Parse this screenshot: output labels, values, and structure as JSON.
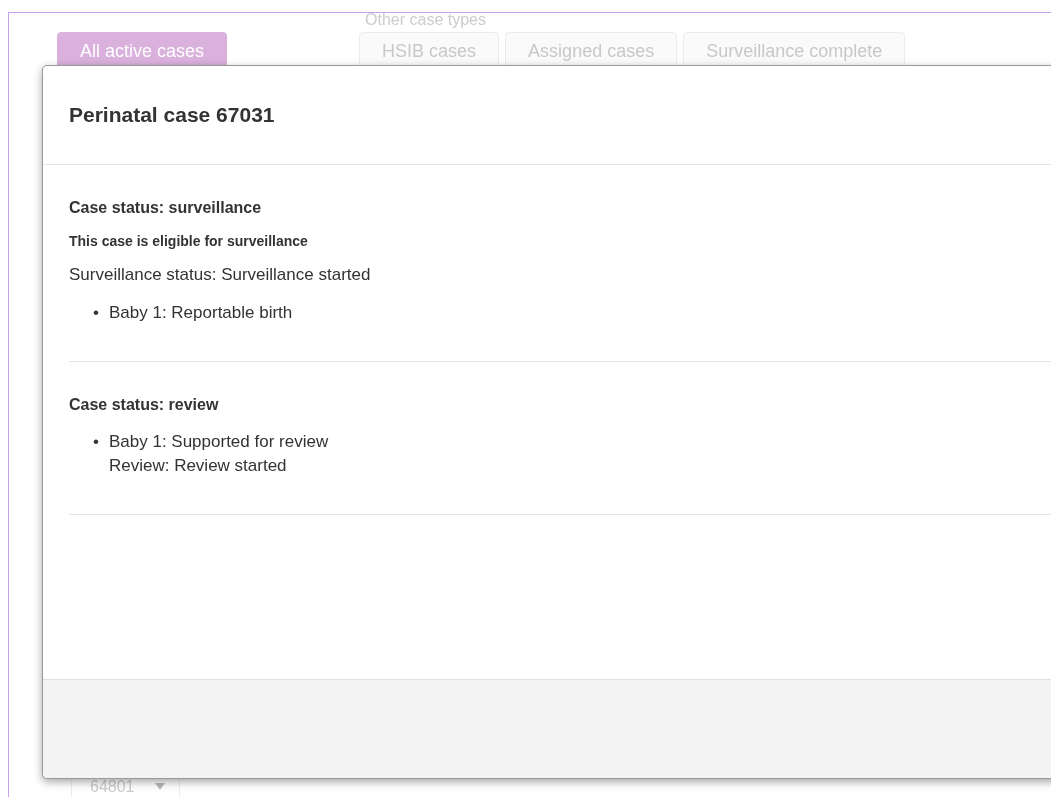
{
  "background": {
    "tabs": [
      {
        "label": "All active cases",
        "selected": true
      }
    ],
    "other_case_types": {
      "label": "Other case types",
      "tabs": [
        {
          "label": "HSIB cases",
          "selected": false
        },
        {
          "label": "Assigned cases",
          "selected": false
        },
        {
          "label": "Surveillance complete",
          "selected": false
        }
      ]
    },
    "row": {
      "case_id": "64801"
    }
  },
  "modal": {
    "title": "Perinatal case 67031",
    "sections": [
      {
        "heading": "Case status: surveillance",
        "note": "This case is eligible for surveillance",
        "status": "Surveillance status: Surveillance started",
        "items": [
          {
            "bullet": "•",
            "lines": [
              "Baby 1: Reportable birth"
            ]
          }
        ]
      },
      {
        "heading": "Case status: review",
        "items": [
          {
            "bullet": "•",
            "lines": [
              "Baby 1: Supported for review",
              "Review: Review started"
            ]
          }
        ]
      }
    ]
  }
}
